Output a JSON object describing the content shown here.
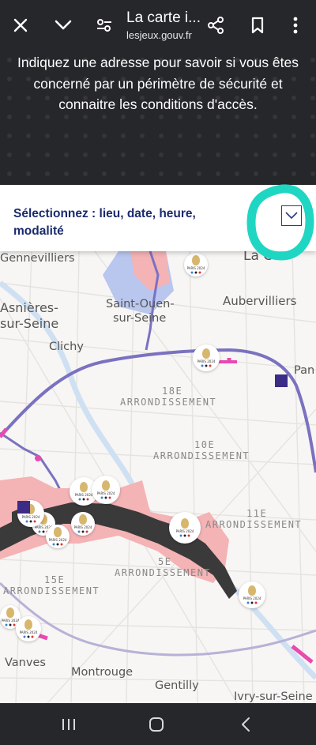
{
  "browser": {
    "title": "La carte i...",
    "url": "lesjeux.gouv.fr",
    "icons": [
      "close-icon",
      "chevron-down-icon",
      "page-settings-icon",
      "share-icon",
      "bookmark-icon",
      "more-icon"
    ]
  },
  "banner": {
    "text": "Indiquez une adresse pour savoir si vous êtes concerné par un périmètre de sécurité et connaitre les conditions d'accès."
  },
  "selector": {
    "label": "Sélectionnez : lieu, date, heure, modalité",
    "icon": "chevron-down-icon",
    "highlight_color": "#1fd6c3"
  },
  "map": {
    "places": {
      "gennevilliers": "Gennevilliers",
      "la_courneuve": "La C",
      "asnieres": "Asnières-",
      "sur_seine": "sur-Seine",
      "saint_ouen_1": "Saint-Ouen-",
      "saint_ouen_2": "sur-Seine",
      "aubervilliers": "Aubervilliers",
      "clichy": "Clichy",
      "pantin": "Pan",
      "vanves": "Vanves",
      "montrouge": "Montrouge",
      "gentilly": "Gentilly",
      "ivry": "Ivry-sur-Seine"
    },
    "arrondissements": {
      "a18_num": "18E",
      "a18_word": "ARRONDISSEMENT",
      "a10_num": "10E",
      "a10_word": "ARRONDISSEMENT",
      "a11_num": "11E",
      "a11_word": "ARRONDISSEMENT",
      "a5_num": "5E",
      "a5_word": "ARRONDISSEMENT",
      "a15_num": "15E",
      "a15_word": "ARRONDISSEMENT"
    },
    "venue_text": "PARIS 2024",
    "colors": {
      "perimeter": "#f4b3b5",
      "seine_zone": "#3a3a3a",
      "route": "#7a72c0",
      "pink_route": "#e84ab0",
      "para_badge": "#3b2c86"
    }
  },
  "system_nav": {
    "icons": [
      "recent-apps-icon",
      "home-icon",
      "back-icon"
    ]
  }
}
